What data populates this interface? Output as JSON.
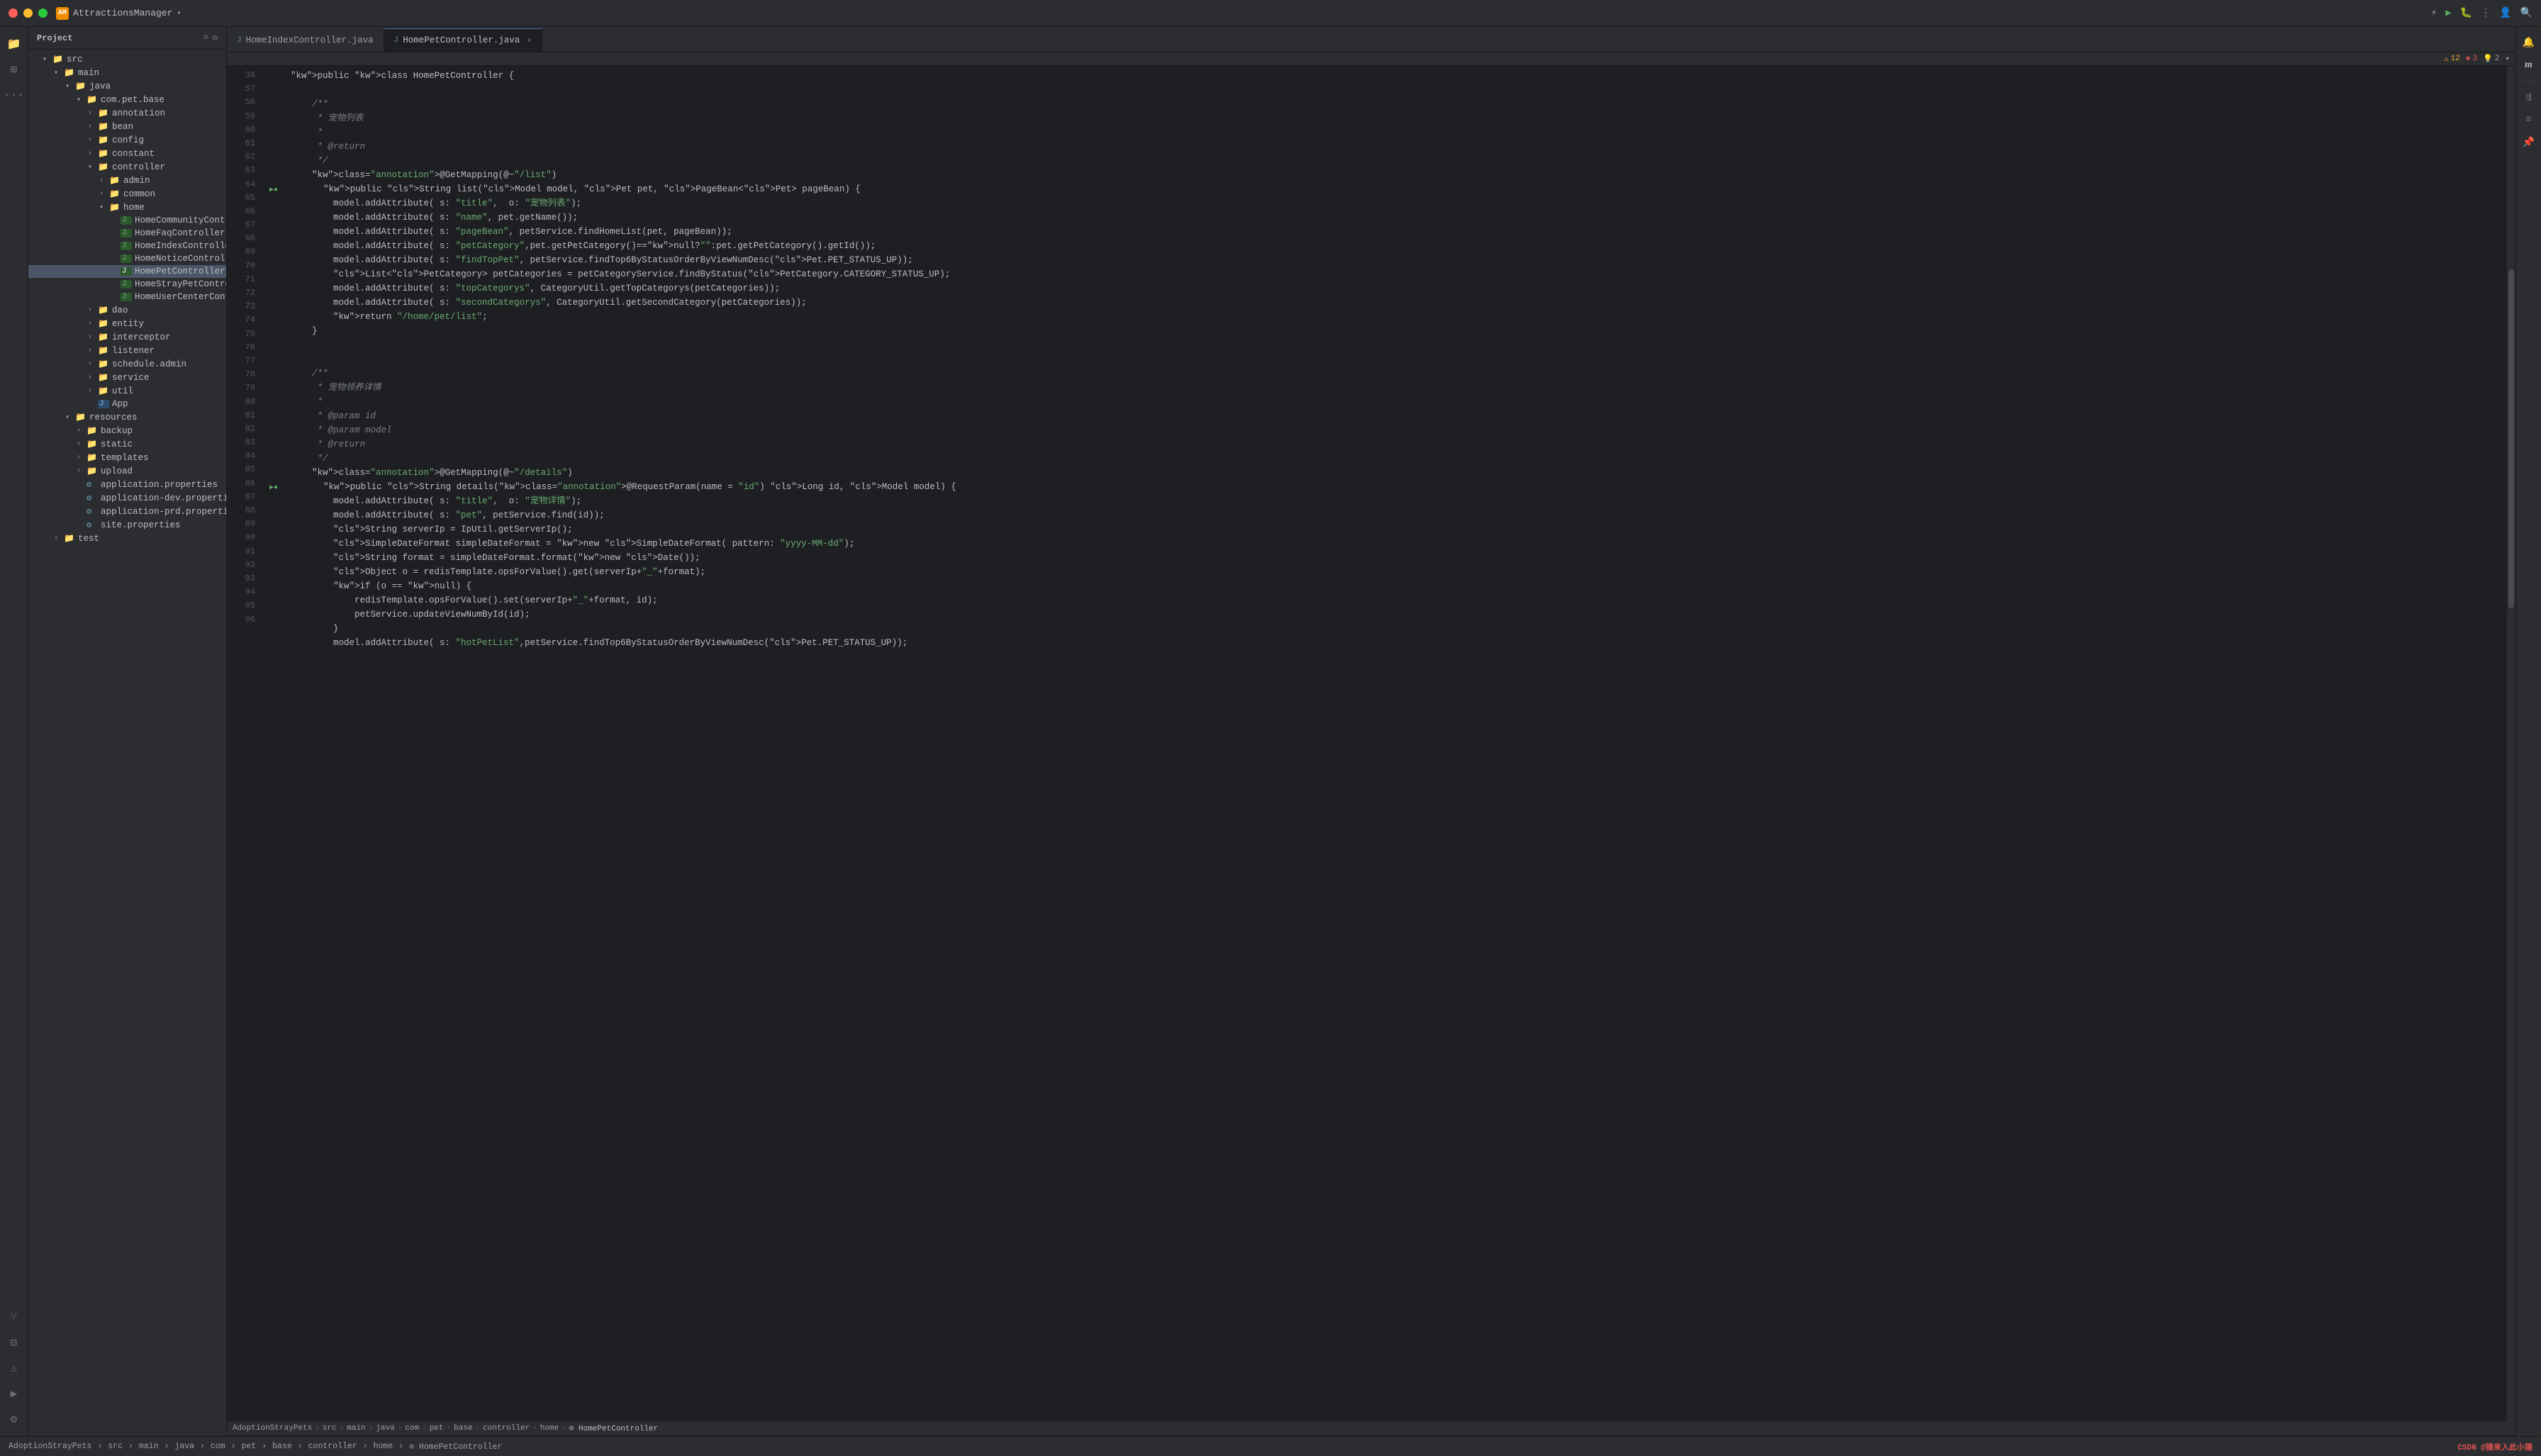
{
  "titleBar": {
    "appName": "AttractionsManager",
    "appIconLabel": "AM",
    "controls": [
      "close",
      "minimize",
      "maximize"
    ]
  },
  "sidebar": {
    "title": "Project",
    "tree": [
      {
        "id": "src",
        "label": "src",
        "type": "folder",
        "indent": 1,
        "expanded": true
      },
      {
        "id": "main",
        "label": "main",
        "type": "folder",
        "indent": 2,
        "expanded": true
      },
      {
        "id": "java",
        "label": "java",
        "type": "folder",
        "indent": 3,
        "expanded": true
      },
      {
        "id": "com.pet.base",
        "label": "com.pet.base",
        "type": "folder",
        "indent": 4,
        "expanded": true
      },
      {
        "id": "annotation",
        "label": "annotation",
        "type": "folder",
        "indent": 5,
        "expanded": false
      },
      {
        "id": "bean",
        "label": "bean",
        "type": "folder",
        "indent": 5,
        "expanded": false
      },
      {
        "id": "config",
        "label": "config",
        "type": "folder",
        "indent": 5,
        "expanded": false
      },
      {
        "id": "constant",
        "label": "constant",
        "type": "folder",
        "indent": 5,
        "expanded": false
      },
      {
        "id": "controller",
        "label": "controller",
        "type": "folder",
        "indent": 5,
        "expanded": true
      },
      {
        "id": "admin",
        "label": "admin",
        "type": "folder",
        "indent": 6,
        "expanded": false
      },
      {
        "id": "common",
        "label": "common",
        "type": "folder",
        "indent": 6,
        "expanded": false
      },
      {
        "id": "home",
        "label": "home",
        "type": "folder",
        "indent": 6,
        "expanded": true
      },
      {
        "id": "HomeCommunityContr",
        "label": "HomeCommunityContr",
        "type": "java",
        "indent": 7
      },
      {
        "id": "HomeFaqController",
        "label": "HomeFaqController",
        "type": "java",
        "indent": 7
      },
      {
        "id": "HomeIndexController",
        "label": "HomeIndexController",
        "type": "java",
        "indent": 7
      },
      {
        "id": "HomeNoticeController",
        "label": "HomeNoticeController",
        "type": "java",
        "indent": 7
      },
      {
        "id": "HomePetController",
        "label": "HomePetController",
        "type": "java",
        "indent": 7,
        "selected": true
      },
      {
        "id": "HomeStrayPetControlle",
        "label": "HomeStrayPetControlle",
        "type": "java",
        "indent": 7
      },
      {
        "id": "HomeUserCenterContr",
        "label": "HomeUserCenterContr",
        "type": "java",
        "indent": 7
      },
      {
        "id": "dao",
        "label": "dao",
        "type": "folder",
        "indent": 5,
        "expanded": false
      },
      {
        "id": "entity",
        "label": "entity",
        "type": "folder",
        "indent": 5,
        "expanded": false
      },
      {
        "id": "interceptor",
        "label": "interceptor",
        "type": "folder",
        "indent": 5,
        "expanded": false
      },
      {
        "id": "listener",
        "label": "listener",
        "type": "folder",
        "indent": 5,
        "expanded": false
      },
      {
        "id": "schedule.admin",
        "label": "schedule.admin",
        "type": "folder",
        "indent": 5,
        "expanded": false
      },
      {
        "id": "service",
        "label": "service",
        "type": "folder",
        "indent": 5,
        "expanded": false
      },
      {
        "id": "util",
        "label": "util",
        "type": "folder",
        "indent": 5,
        "expanded": false
      },
      {
        "id": "App",
        "label": "App",
        "type": "java",
        "indent": 5
      },
      {
        "id": "resources",
        "label": "resources",
        "type": "folder",
        "indent": 3,
        "expanded": true
      },
      {
        "id": "backup",
        "label": "backup",
        "type": "folder",
        "indent": 4,
        "expanded": false
      },
      {
        "id": "static",
        "label": "static",
        "type": "folder",
        "indent": 4,
        "expanded": false
      },
      {
        "id": "templates",
        "label": "templates",
        "type": "folder",
        "indent": 4,
        "expanded": false
      },
      {
        "id": "upload",
        "label": "upload",
        "type": "folder",
        "indent": 4,
        "expanded": false
      },
      {
        "id": "application.properties",
        "label": "application.properties",
        "type": "props",
        "indent": 4
      },
      {
        "id": "application-dev.properties",
        "label": "application-dev.properties",
        "type": "props",
        "indent": 4
      },
      {
        "id": "application-prd.properties",
        "label": "application-prd.properties",
        "type": "props",
        "indent": 4
      },
      {
        "id": "site.properties",
        "label": "site.properties",
        "type": "props",
        "indent": 4
      },
      {
        "id": "test",
        "label": "test",
        "type": "folder",
        "indent": 2,
        "expanded": false
      }
    ]
  },
  "tabs": [
    {
      "label": "HomeIndexController.java",
      "active": false,
      "icon": "J"
    },
    {
      "label": "HomePetController.java",
      "active": true,
      "icon": "J"
    }
  ],
  "warnings": {
    "count": "12",
    "errors": "3",
    "hints": "2"
  },
  "breadcrumb": {
    "parts": [
      "AdoptionStrayPets",
      "src",
      "main",
      "java",
      "com",
      "pet",
      "base",
      "controller",
      "home",
      "HomePetController"
    ]
  },
  "code": {
    "startLine": 38,
    "lines": [
      {
        "n": 38,
        "text": "    public class HomePetController {"
      },
      {
        "n": 57,
        "text": ""
      },
      {
        "n": 58,
        "text": "        /**"
      },
      {
        "n": 59,
        "text": "         * 宠物列表"
      },
      {
        "n": 60,
        "text": "         *"
      },
      {
        "n": 61,
        "text": "         * @return"
      },
      {
        "n": 62,
        "text": "         */"
      },
      {
        "n": 63,
        "text": "        @GetMapping(@~\"/list\")"
      },
      {
        "n": 64,
        "text": "        public String list(Model model, Pet pet, PageBean<Pet> pageBean) {",
        "hasIcon": true
      },
      {
        "n": 65,
        "text": "            model.addAttribute( s: \"title\",  o: \"宠物列表\");"
      },
      {
        "n": 66,
        "text": "            model.addAttribute( s: \"name\", pet.getName());"
      },
      {
        "n": 67,
        "text": "            model.addAttribute( s: \"pageBean\", petService.findHomeList(pet, pageBean));"
      },
      {
        "n": 68,
        "text": "            model.addAttribute( s: \"petCategory\",pet.getPetCategory()==null?\"\":pet.getPetCategory().getId());"
      },
      {
        "n": 69,
        "text": "            model.addAttribute( s: \"findTopPet\", petService.findTop6ByStatusOrderByViewNumDesc(Pet.PET_STATUS_UP));"
      },
      {
        "n": 70,
        "text": "            List<PetCategory> petCategories = petCategoryService.findByStatus(PetCategory.CATEGORY_STATUS_UP);"
      },
      {
        "n": 71,
        "text": "            model.addAttribute( s: \"topCategorys\", CategoryUtil.getTopCategorys(petCategories));"
      },
      {
        "n": 72,
        "text": "            model.addAttribute( s: \"secondCategorys\", CategoryUtil.getSecondCategory(petCategories));"
      },
      {
        "n": 73,
        "text": "            return \"/home/pet/list\";"
      },
      {
        "n": 74,
        "text": "        }"
      },
      {
        "n": 75,
        "text": ""
      },
      {
        "n": 76,
        "text": ""
      },
      {
        "n": 77,
        "text": "        /**",
        "hasIndent": true
      },
      {
        "n": 78,
        "text": "         * 宠物领养详情"
      },
      {
        "n": 79,
        "text": "         *"
      },
      {
        "n": 80,
        "text": "         * @param id"
      },
      {
        "n": 81,
        "text": "         * @param model"
      },
      {
        "n": 82,
        "text": "         * @return"
      },
      {
        "n": 83,
        "text": "         */"
      },
      {
        "n": 84,
        "text": "        @GetMapping(@~\"/details\")"
      },
      {
        "n": 85,
        "text": "        public String details(@RequestParam(name = \"id\") Long id, Model model) {",
        "hasIcon": true
      },
      {
        "n": 86,
        "text": "            model.addAttribute( s: \"title\",  o: \"宠物详情\");"
      },
      {
        "n": 87,
        "text": "            model.addAttribute( s: \"pet\", petService.find(id));"
      },
      {
        "n": 88,
        "text": "            String serverIp = IpUtil.getServerIp();"
      },
      {
        "n": 89,
        "text": "            SimpleDateFormat simpleDateFormat = new SimpleDateFormat( pattern: \"yyyy-MM-dd\");"
      },
      {
        "n": 90,
        "text": "            String format = simpleDateFormat.format(new Date());"
      },
      {
        "n": 91,
        "text": "            Object o = redisTemplate.opsForValue().get(serverIp+\"_\"+format);"
      },
      {
        "n": 92,
        "text": "            if (o == null) {"
      },
      {
        "n": 93,
        "text": "                redisTemplate.opsForValue().set(serverIp+\"_\"+format, id);"
      },
      {
        "n": 94,
        "text": "                petService.updateViewNumById(id);"
      },
      {
        "n": 95,
        "text": "            }"
      },
      {
        "n": 96,
        "text": "            model.addAttribute( s: \"hotPetList\",petService.findTop6ByStatusOrderByViewNumDesc(Pet.PET_STATUS_UP));"
      }
    ]
  },
  "bottomBar": {
    "breadcrumb": [
      "AdoptionStrayPets",
      "src",
      "main",
      "java",
      "com",
      "pet",
      "base",
      "controller",
      "home",
      "HomePetController"
    ],
    "watermark": "CSDN @猿来入此小猿"
  }
}
